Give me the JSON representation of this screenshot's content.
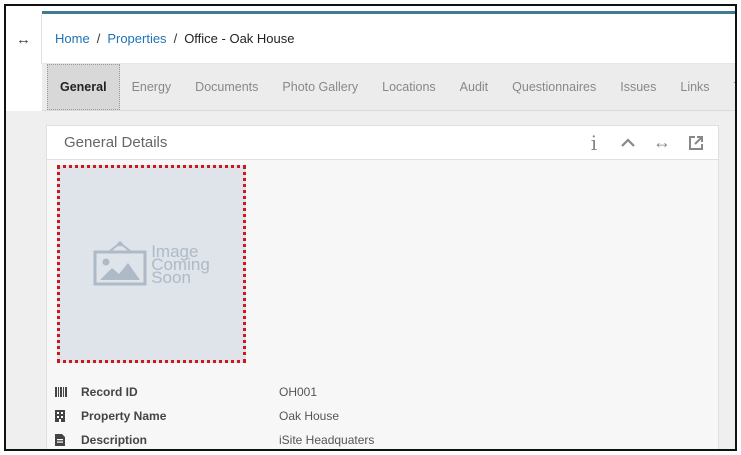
{
  "gutter": {
    "icon": "expand-horizontal-icon",
    "glyph": "↔"
  },
  "breadcrumb": {
    "items": [
      "Home",
      "Properties"
    ],
    "separator": "/",
    "current": "Office - Oak House"
  },
  "tabs": [
    {
      "label": "General",
      "active": true
    },
    {
      "label": "Energy"
    },
    {
      "label": "Documents"
    },
    {
      "label": "Photo Gallery"
    },
    {
      "label": "Locations"
    },
    {
      "label": "Audit"
    },
    {
      "label": "Questionnaires"
    },
    {
      "label": "Issues"
    },
    {
      "label": "Links"
    },
    {
      "label": "Tasks"
    }
  ],
  "panel": {
    "title": "General Details",
    "tools": {
      "info_glyph": "i",
      "collapse_glyph": "^",
      "expand_glyph": "↔",
      "external_icon": "external-link-icon"
    }
  },
  "image_placeholder": {
    "line1": "Image",
    "line2": "Coming",
    "line3": "Soon"
  },
  "details": [
    {
      "icon": "barcode-icon",
      "label": "Record ID",
      "value": "OH001"
    },
    {
      "icon": "building-icon",
      "label": "Property Name",
      "value": "Oak House"
    },
    {
      "icon": "document-icon",
      "label": "Description",
      "value": "iSite Headquaters"
    }
  ],
  "colors": {
    "accent": "#3d7d8e",
    "link": "#1f73b7",
    "highlight_border": "#cc1818",
    "placeholder_bg": "#dfe3ea",
    "placeholder_fg": "#a9b6c4"
  }
}
